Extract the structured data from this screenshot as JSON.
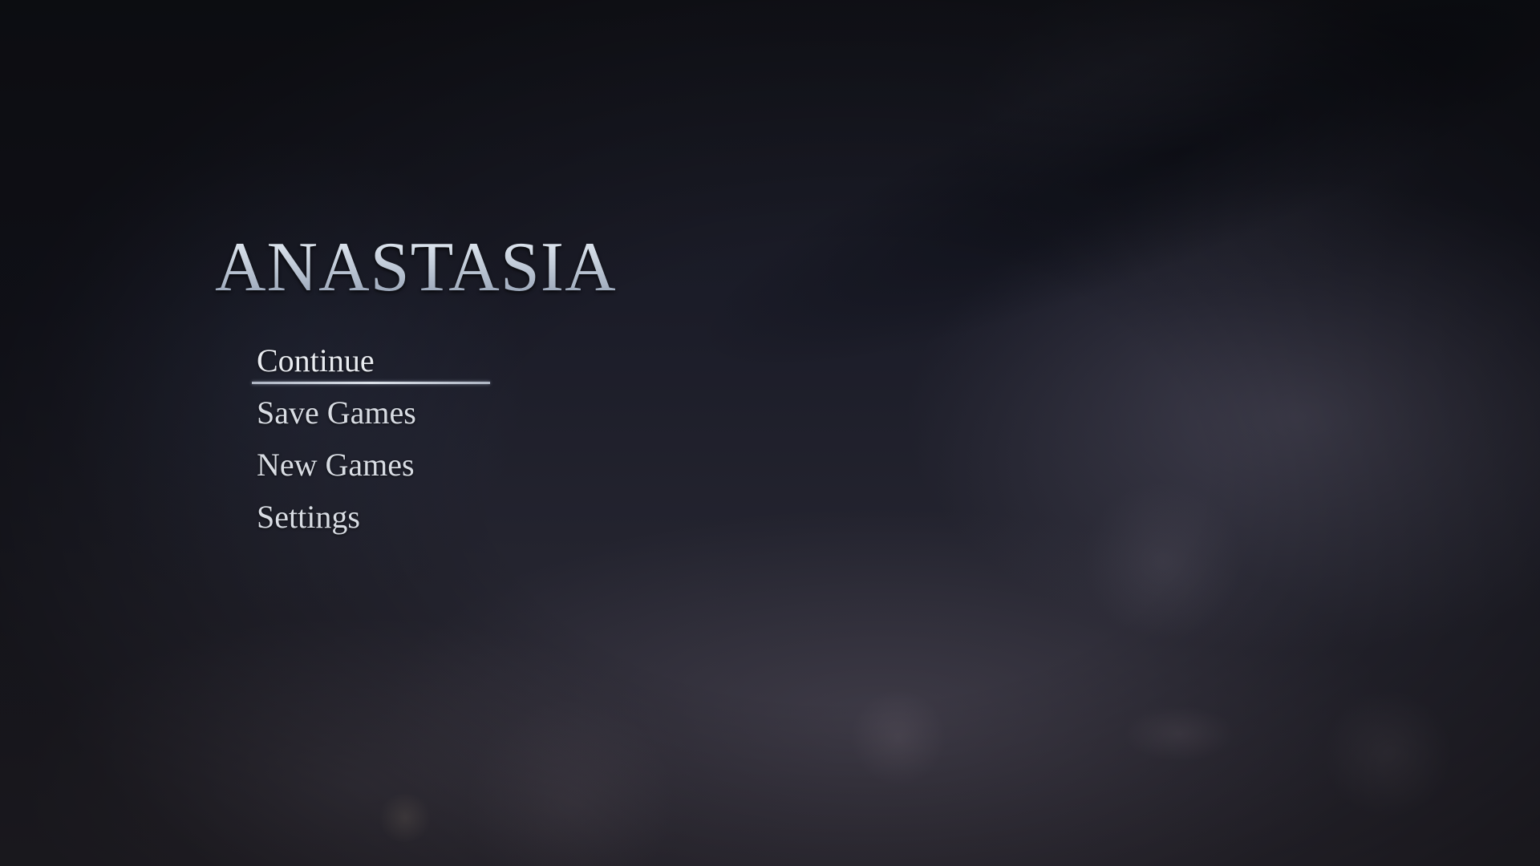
{
  "game": {
    "title": "ANASTASIA"
  },
  "menu": {
    "selected_index": 0,
    "items": [
      {
        "label": "Continue"
      },
      {
        "label": "Save Games"
      },
      {
        "label": "New Games"
      },
      {
        "label": "Settings"
      }
    ]
  },
  "colors": {
    "title_silver": "#c5cfdc",
    "menu_text": "#d8dce3",
    "background": "#1b1c28"
  }
}
